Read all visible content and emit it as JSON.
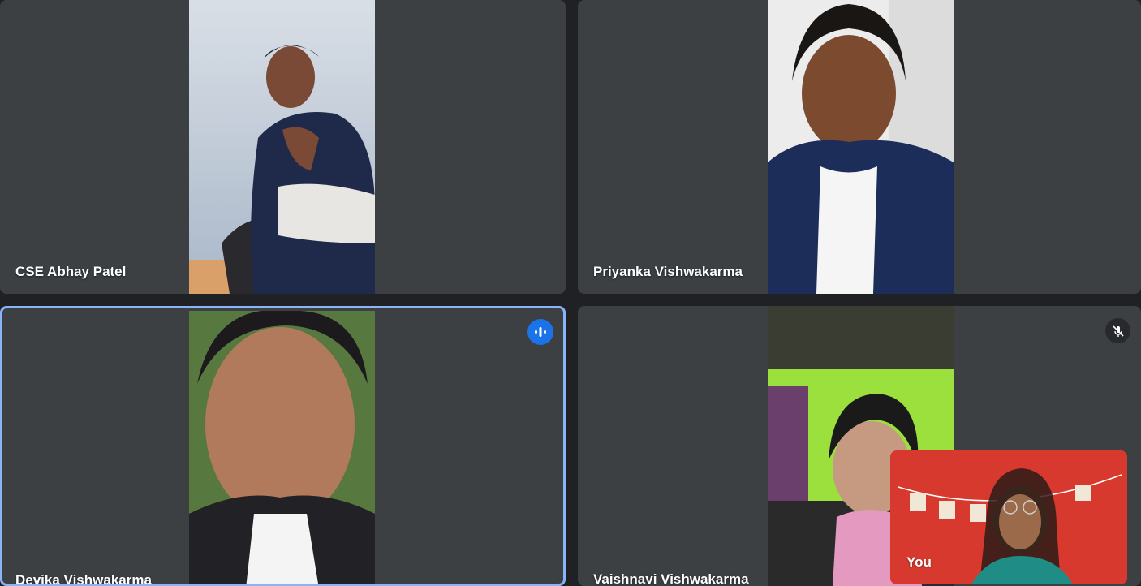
{
  "participants": [
    {
      "name": "CSE Abhay Patel",
      "speaking": false,
      "muted": false
    },
    {
      "name": "Priyanka Vishwakarma",
      "speaking": false,
      "muted": false
    },
    {
      "name": "Devika Vishwakarma",
      "speaking": true,
      "muted": false
    },
    {
      "name": "Vaishnavi Vishwakarma",
      "speaking": false,
      "muted": true
    }
  ],
  "self_view": {
    "label": "You"
  },
  "icons": {
    "speaking": "audio-level-icon",
    "muted": "mic-off-icon"
  },
  "colors": {
    "background": "#202124",
    "tile": "#3c4043",
    "speaking_border": "#8ab4f8",
    "speaking_badge": "#1a73e8"
  }
}
